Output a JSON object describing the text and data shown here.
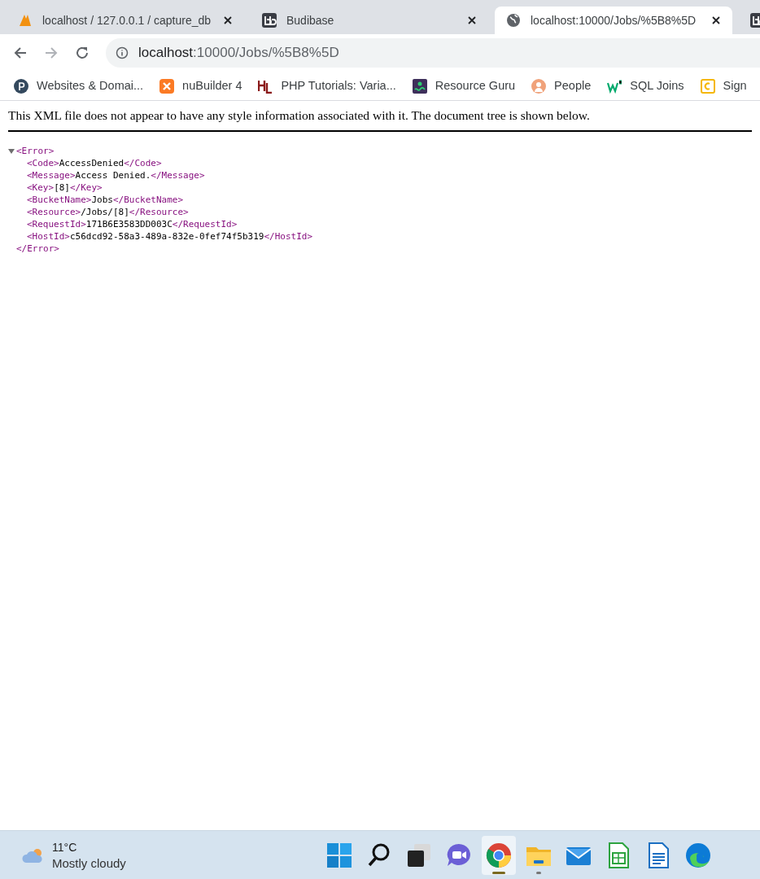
{
  "tabs": [
    {
      "kind": "pma",
      "title": "localhost / 127.0.0.1 / capture_db",
      "selected": false
    },
    {
      "kind": "budibase",
      "title": "Budibase",
      "selected": false
    },
    {
      "kind": "globe",
      "title": "localhost:10000/Jobs/%5B8%5D",
      "selected": true
    },
    {
      "kind": "budibase",
      "selected": false
    }
  ],
  "address": {
    "host": "localhost",
    "path": ":10000/Jobs/%5B8%5D"
  },
  "bookmarks": [
    {
      "kind": "letter",
      "label": "Websites & Domai..."
    },
    {
      "kind": "xampp",
      "label": "nuBuilder 4"
    },
    {
      "kind": "hl",
      "label": "PHP Tutorials: Varia..."
    },
    {
      "kind": "guru",
      "label": "Resource Guru"
    },
    {
      "kind": "person",
      "label": "People"
    },
    {
      "kind": "w3",
      "label": "SQL Joins"
    },
    {
      "kind": "cbox",
      "label": "Sign"
    }
  ],
  "notice": "This XML file does not appear to have any style information associated with it. The document tree is shown below.",
  "xml": {
    "open": "<Error>",
    "close": "</Error>",
    "expanded": true,
    "children": [
      {
        "open": "<Code>",
        "value": "AccessDenied",
        "close": "</Code>"
      },
      {
        "open": "<Message>",
        "value": "Access Denied.",
        "close": "</Message>"
      },
      {
        "open": "<Key>",
        "value": "[8]",
        "close": "</Key>"
      },
      {
        "open": "<BucketName>",
        "value": "Jobs",
        "close": "</BucketName>"
      },
      {
        "open": "<Resource>",
        "value": "/Jobs/[8]",
        "close": "</Resource>"
      },
      {
        "open": "<RequestId>",
        "value": "171B6E3583DD003C",
        "close": "</RequestId>"
      },
      {
        "open": "<HostId>",
        "value": "c56dcd92-58a3-489a-832e-0fef74f5b319",
        "close": "</HostId>"
      }
    ]
  },
  "taskbar": {
    "weather": {
      "temperature": "11°C",
      "condition": "Mostly cloudy"
    },
    "apps": [
      {
        "kind": "start",
        "selected": false,
        "running": false
      },
      {
        "kind": "search",
        "selected": false,
        "running": false
      },
      {
        "kind": "taskview",
        "selected": false,
        "running": false
      },
      {
        "kind": "chat",
        "selected": false,
        "running": false
      },
      {
        "kind": "chrome",
        "selected": true,
        "running": true
      },
      {
        "kind": "folder",
        "selected": false,
        "running": true
      },
      {
        "kind": "mail",
        "selected": false,
        "running": false
      },
      {
        "kind": "calc",
        "selected": false,
        "running": false
      },
      {
        "kind": "writer",
        "selected": false,
        "running": false
      },
      {
        "kind": "edge",
        "selected": false,
        "running": false
      }
    ]
  }
}
